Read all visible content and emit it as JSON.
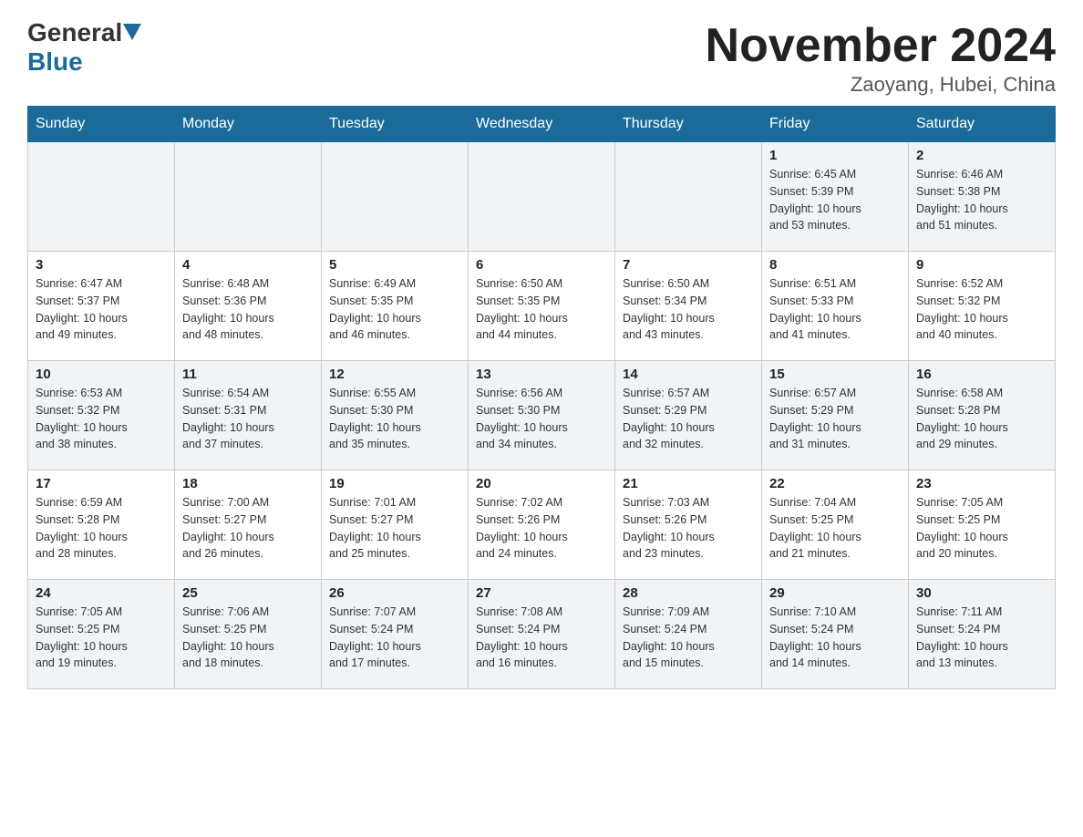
{
  "header": {
    "logo": {
      "part1": "General",
      "part2": "Blue"
    },
    "title": "November 2024",
    "location": "Zaoyang, Hubei, China"
  },
  "weekdays": [
    "Sunday",
    "Monday",
    "Tuesday",
    "Wednesday",
    "Thursday",
    "Friday",
    "Saturday"
  ],
  "weeks": [
    [
      {
        "day": "",
        "info": ""
      },
      {
        "day": "",
        "info": ""
      },
      {
        "day": "",
        "info": ""
      },
      {
        "day": "",
        "info": ""
      },
      {
        "day": "",
        "info": ""
      },
      {
        "day": "1",
        "info": "Sunrise: 6:45 AM\nSunset: 5:39 PM\nDaylight: 10 hours\nand 53 minutes."
      },
      {
        "day": "2",
        "info": "Sunrise: 6:46 AM\nSunset: 5:38 PM\nDaylight: 10 hours\nand 51 minutes."
      }
    ],
    [
      {
        "day": "3",
        "info": "Sunrise: 6:47 AM\nSunset: 5:37 PM\nDaylight: 10 hours\nand 49 minutes."
      },
      {
        "day": "4",
        "info": "Sunrise: 6:48 AM\nSunset: 5:36 PM\nDaylight: 10 hours\nand 48 minutes."
      },
      {
        "day": "5",
        "info": "Sunrise: 6:49 AM\nSunset: 5:35 PM\nDaylight: 10 hours\nand 46 minutes."
      },
      {
        "day": "6",
        "info": "Sunrise: 6:50 AM\nSunset: 5:35 PM\nDaylight: 10 hours\nand 44 minutes."
      },
      {
        "day": "7",
        "info": "Sunrise: 6:50 AM\nSunset: 5:34 PM\nDaylight: 10 hours\nand 43 minutes."
      },
      {
        "day": "8",
        "info": "Sunrise: 6:51 AM\nSunset: 5:33 PM\nDaylight: 10 hours\nand 41 minutes."
      },
      {
        "day": "9",
        "info": "Sunrise: 6:52 AM\nSunset: 5:32 PM\nDaylight: 10 hours\nand 40 minutes."
      }
    ],
    [
      {
        "day": "10",
        "info": "Sunrise: 6:53 AM\nSunset: 5:32 PM\nDaylight: 10 hours\nand 38 minutes."
      },
      {
        "day": "11",
        "info": "Sunrise: 6:54 AM\nSunset: 5:31 PM\nDaylight: 10 hours\nand 37 minutes."
      },
      {
        "day": "12",
        "info": "Sunrise: 6:55 AM\nSunset: 5:30 PM\nDaylight: 10 hours\nand 35 minutes."
      },
      {
        "day": "13",
        "info": "Sunrise: 6:56 AM\nSunset: 5:30 PM\nDaylight: 10 hours\nand 34 minutes."
      },
      {
        "day": "14",
        "info": "Sunrise: 6:57 AM\nSunset: 5:29 PM\nDaylight: 10 hours\nand 32 minutes."
      },
      {
        "day": "15",
        "info": "Sunrise: 6:57 AM\nSunset: 5:29 PM\nDaylight: 10 hours\nand 31 minutes."
      },
      {
        "day": "16",
        "info": "Sunrise: 6:58 AM\nSunset: 5:28 PM\nDaylight: 10 hours\nand 29 minutes."
      }
    ],
    [
      {
        "day": "17",
        "info": "Sunrise: 6:59 AM\nSunset: 5:28 PM\nDaylight: 10 hours\nand 28 minutes."
      },
      {
        "day": "18",
        "info": "Sunrise: 7:00 AM\nSunset: 5:27 PM\nDaylight: 10 hours\nand 26 minutes."
      },
      {
        "day": "19",
        "info": "Sunrise: 7:01 AM\nSunset: 5:27 PM\nDaylight: 10 hours\nand 25 minutes."
      },
      {
        "day": "20",
        "info": "Sunrise: 7:02 AM\nSunset: 5:26 PM\nDaylight: 10 hours\nand 24 minutes."
      },
      {
        "day": "21",
        "info": "Sunrise: 7:03 AM\nSunset: 5:26 PM\nDaylight: 10 hours\nand 23 minutes."
      },
      {
        "day": "22",
        "info": "Sunrise: 7:04 AM\nSunset: 5:25 PM\nDaylight: 10 hours\nand 21 minutes."
      },
      {
        "day": "23",
        "info": "Sunrise: 7:05 AM\nSunset: 5:25 PM\nDaylight: 10 hours\nand 20 minutes."
      }
    ],
    [
      {
        "day": "24",
        "info": "Sunrise: 7:05 AM\nSunset: 5:25 PM\nDaylight: 10 hours\nand 19 minutes."
      },
      {
        "day": "25",
        "info": "Sunrise: 7:06 AM\nSunset: 5:25 PM\nDaylight: 10 hours\nand 18 minutes."
      },
      {
        "day": "26",
        "info": "Sunrise: 7:07 AM\nSunset: 5:24 PM\nDaylight: 10 hours\nand 17 minutes."
      },
      {
        "day": "27",
        "info": "Sunrise: 7:08 AM\nSunset: 5:24 PM\nDaylight: 10 hours\nand 16 minutes."
      },
      {
        "day": "28",
        "info": "Sunrise: 7:09 AM\nSunset: 5:24 PM\nDaylight: 10 hours\nand 15 minutes."
      },
      {
        "day": "29",
        "info": "Sunrise: 7:10 AM\nSunset: 5:24 PM\nDaylight: 10 hours\nand 14 minutes."
      },
      {
        "day": "30",
        "info": "Sunrise: 7:11 AM\nSunset: 5:24 PM\nDaylight: 10 hours\nand 13 minutes."
      }
    ]
  ]
}
